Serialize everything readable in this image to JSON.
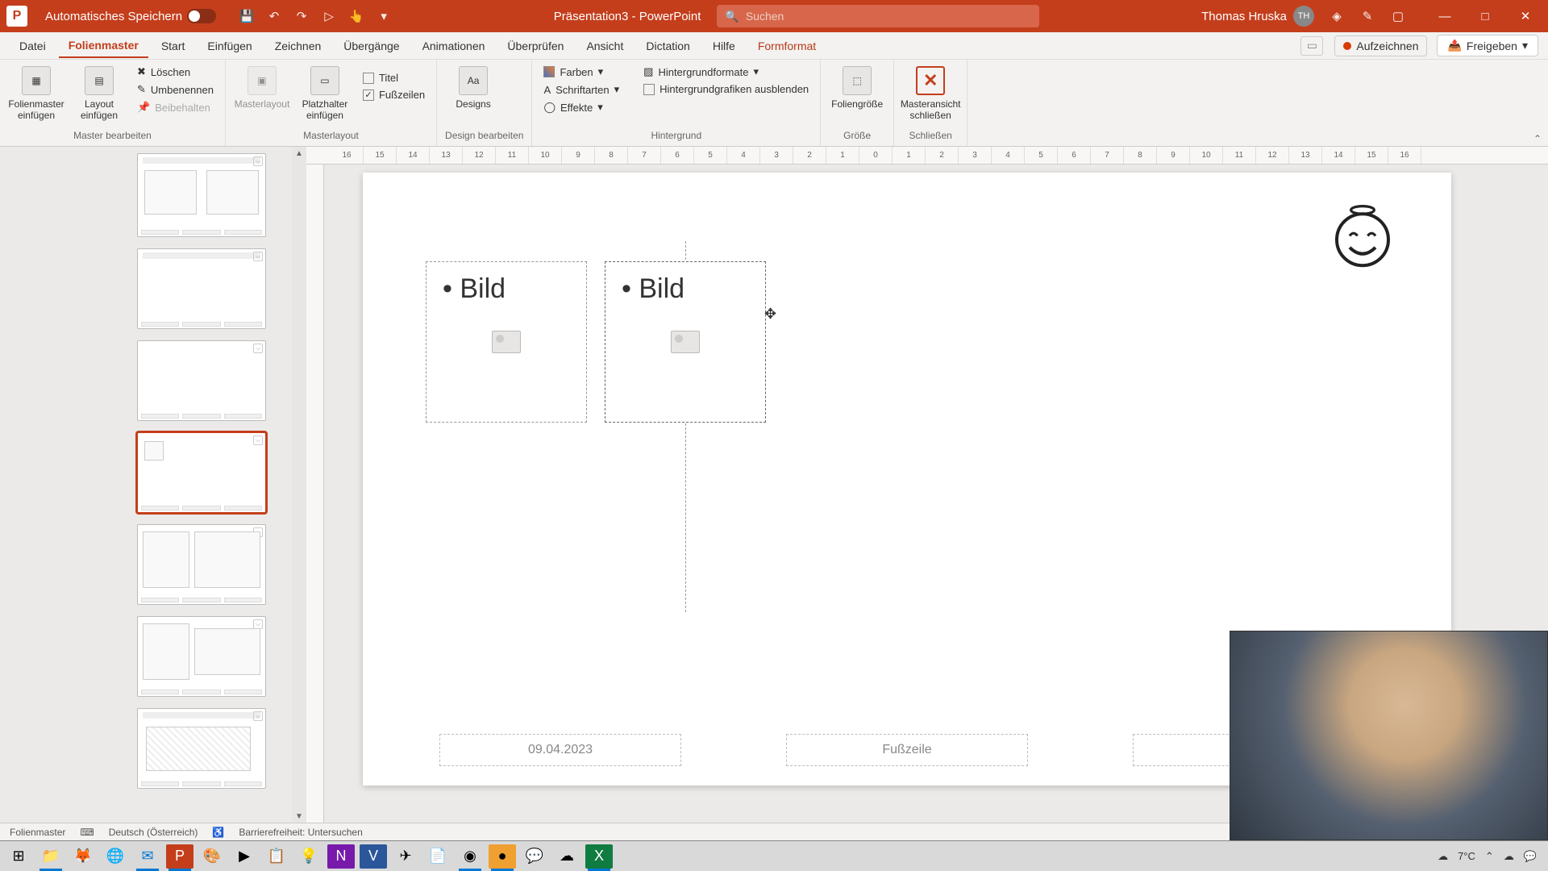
{
  "titlebar": {
    "autosave_label": "Automatisches Speichern",
    "doc_title": "Präsentation3 - PowerPoint",
    "search_placeholder": "Suchen",
    "user_name": "Thomas Hruska",
    "user_initials": "TH"
  },
  "tabs": {
    "datei": "Datei",
    "folienmaster": "Folienmaster",
    "start": "Start",
    "einfuegen": "Einfügen",
    "zeichnen": "Zeichnen",
    "uebergaenge": "Übergänge",
    "animationen": "Animationen",
    "ueberpruefen": "Überprüfen",
    "ansicht": "Ansicht",
    "dictation": "Dictation",
    "hilfe": "Hilfe",
    "formformat": "Formformat",
    "aufzeichnen": "Aufzeichnen",
    "freigeben": "Freigeben"
  },
  "ribbon": {
    "folienmaster_einfuegen": "Folienmaster einfügen",
    "layout_einfuegen": "Layout einfügen",
    "loeschen": "Löschen",
    "umbenennen": "Umbenennen",
    "beibehalten": "Beibehalten",
    "group_master_bearbeiten": "Master bearbeiten",
    "masterlayout": "Masterlayout",
    "platzhalter_einfuegen": "Platzhalter einfügen",
    "titel": "Titel",
    "fusszeilen": "Fußzeilen",
    "group_masterlayout": "Masterlayout",
    "designs": "Designs",
    "group_design_bearbeiten": "Design bearbeiten",
    "farben": "Farben",
    "schriftarten": "Schriftarten",
    "effekte": "Effekte",
    "hintergrundformate": "Hintergrundformate",
    "hintergrundgrafiken_ausblenden": "Hintergrundgrafiken ausblenden",
    "group_hintergrund": "Hintergrund",
    "foliengroesse": "Foliengröße",
    "group_groesse": "Größe",
    "masteransicht_schliessen": "Masteransicht schließen",
    "group_schliessen": "Schließen"
  },
  "ruler_h": [
    "16",
    "15",
    "14",
    "13",
    "12",
    "11",
    "10",
    "9",
    "8",
    "7",
    "6",
    "5",
    "4",
    "3",
    "2",
    "1",
    "0",
    "1",
    "2",
    "3",
    "4",
    "5",
    "6",
    "7",
    "8",
    "9",
    "10",
    "11",
    "12",
    "13",
    "14",
    "15",
    "16"
  ],
  "slide": {
    "placeholder1_text": "Bild",
    "placeholder2_text": "Bild",
    "date": "09.04.2023",
    "footer": "Fußzeile"
  },
  "statusbar": {
    "view": "Folienmaster",
    "language": "Deutsch (Österreich)",
    "accessibility": "Barrierefreiheit: Untersuchen"
  },
  "taskbar": {
    "temp": "7°C"
  }
}
